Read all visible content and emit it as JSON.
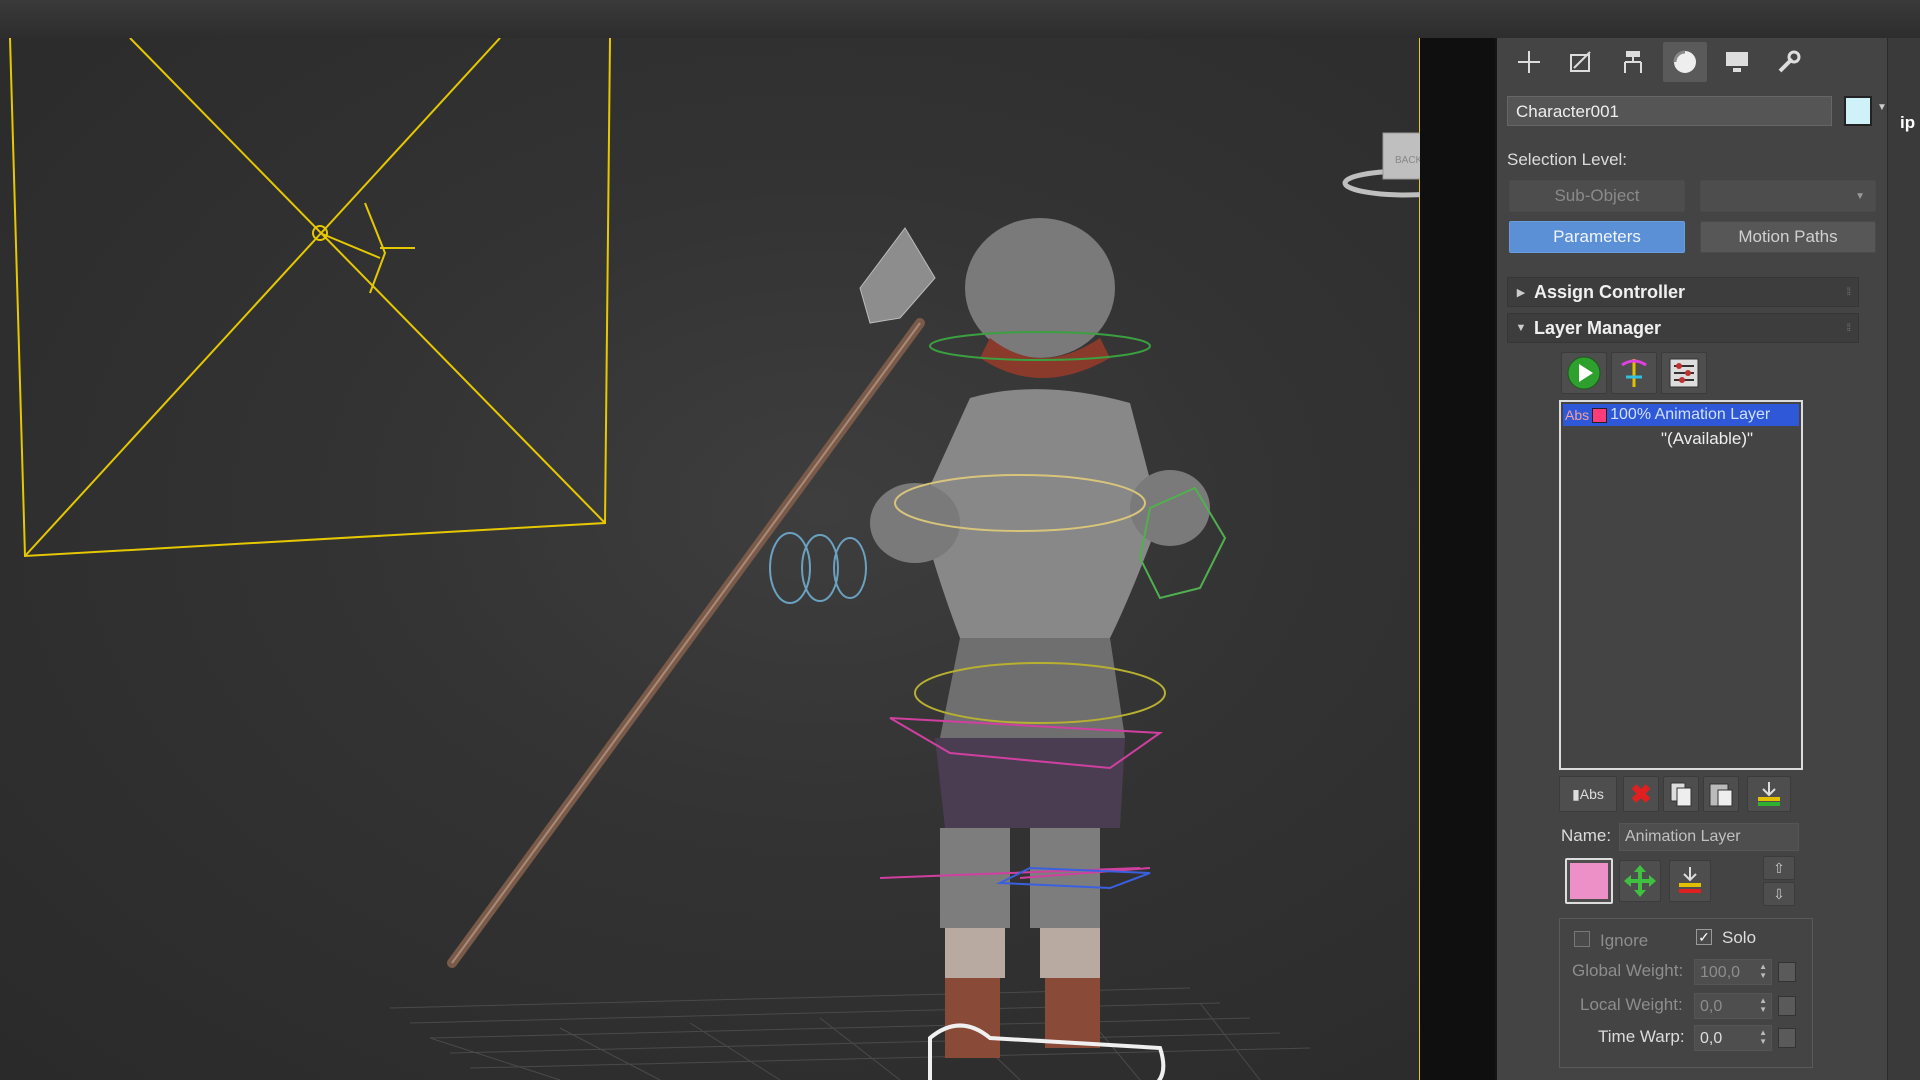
{
  "object_name": "Character001",
  "object_color": "#cff2f8",
  "selection_level": {
    "label": "Selection Level:",
    "sub_object": "Sub-Object",
    "dropdown_value": ""
  },
  "tabs": {
    "parameters": "Parameters",
    "motion_paths": "Motion Paths"
  },
  "rollouts": {
    "assign_controller": "Assign Controller",
    "layer_manager": "Layer Manager"
  },
  "layer_list": {
    "active_layer_prefix": "Abs",
    "active_layer": "100% Animation Layer",
    "available": "\"(Available)\""
  },
  "layer_buttons": {
    "abs_label": "Abs"
  },
  "name_field": {
    "label": "Name:",
    "value": "Animation Layer"
  },
  "layer_color": "#ee90c8",
  "properties": {
    "ignore_label": "Ignore",
    "solo_label": "Solo",
    "global_weight_label": "Global Weight:",
    "global_weight_value": "100,0",
    "local_weight_label": "Local Weight:",
    "local_weight_value": "0,0",
    "time_warp_label": "Time Warp:",
    "time_warp_value": "0,0"
  },
  "viewcube_face": "BACK",
  "side_strip_text": "ip",
  "toolbar_icons": [
    "create-icon",
    "modify-icon",
    "hierarchy-icon",
    "motion-icon",
    "display-icon",
    "utilities-icon"
  ]
}
